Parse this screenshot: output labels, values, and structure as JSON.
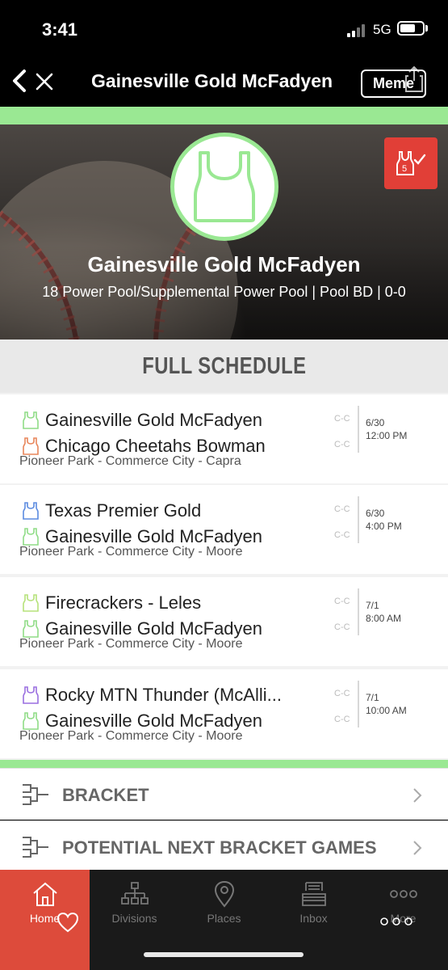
{
  "status_bar": {
    "time": "3:41",
    "network": "5G",
    "battery_level": 0.7
  },
  "nav": {
    "title": "Gainesville Gold McFadyen",
    "meme_label": "Meme"
  },
  "hero": {
    "team_name": "Gainesville Gold McFadyen",
    "subtitle": "18 Power Pool/Supplemental Power Pool | Pool BD | 0-0",
    "badge_number": "5"
  },
  "schedule": {
    "header": "FULL SCHEDULE",
    "games": [
      {
        "home": {
          "name": "Gainesville Gold McFadyen",
          "icon_color": "#8fdc86",
          "score": "C-C"
        },
        "away": {
          "name": "Chicago Cheetahs Bowman",
          "icon_color": "#e8855a",
          "score": "C-C"
        },
        "venue": "Pioneer Park - Commerce City - Capra",
        "date": "6/30",
        "time": "12:00 PM"
      },
      {
        "home": {
          "name": "Texas Premier Gold",
          "icon_color": "#5b8be0",
          "score": "C-C"
        },
        "away": {
          "name": "Gainesville Gold McFadyen",
          "icon_color": "#8fdc86",
          "score": "C-C"
        },
        "venue": "Pioneer Park - Commerce City - Moore",
        "date": "6/30",
        "time": "4:00 PM"
      },
      {
        "home": {
          "name": "Firecrackers - Leles",
          "icon_color": "#b6e27a",
          "score": "C-C"
        },
        "away": {
          "name": "Gainesville Gold McFadyen",
          "icon_color": "#8fdc86",
          "score": "C-C"
        },
        "venue": "Pioneer Park - Commerce City - Moore",
        "date": "7/1",
        "time": "8:00 AM"
      },
      {
        "home": {
          "name": "Rocky MTN Thunder (McAlli...",
          "icon_color": "#9a6fe0",
          "score": "C-C"
        },
        "away": {
          "name": "Gainesville Gold McFadyen",
          "icon_color": "#8fdc86",
          "score": "C-C"
        },
        "venue": "Pioneer Park - Commerce City - Moore",
        "date": "7/1",
        "time": "10:00 AM"
      }
    ]
  },
  "links": {
    "bracket": "BRACKET",
    "next_games": "POTENTIAL NEXT BRACKET GAMES"
  },
  "tabs": [
    {
      "label": "Home",
      "icon": "home-icon",
      "active": true
    },
    {
      "label": "Divisions",
      "icon": "hierarchy-icon",
      "active": false
    },
    {
      "label": "Places",
      "icon": "map-pin-icon",
      "active": false
    },
    {
      "label": "Inbox",
      "icon": "inbox-icon",
      "active": false
    },
    {
      "label": "More",
      "icon": "more-dots-icon",
      "active": false
    }
  ],
  "colors": {
    "accent_green": "#9ae893",
    "accent_red": "#dd4b3b",
    "tab_bg": "#1a1a1a"
  }
}
